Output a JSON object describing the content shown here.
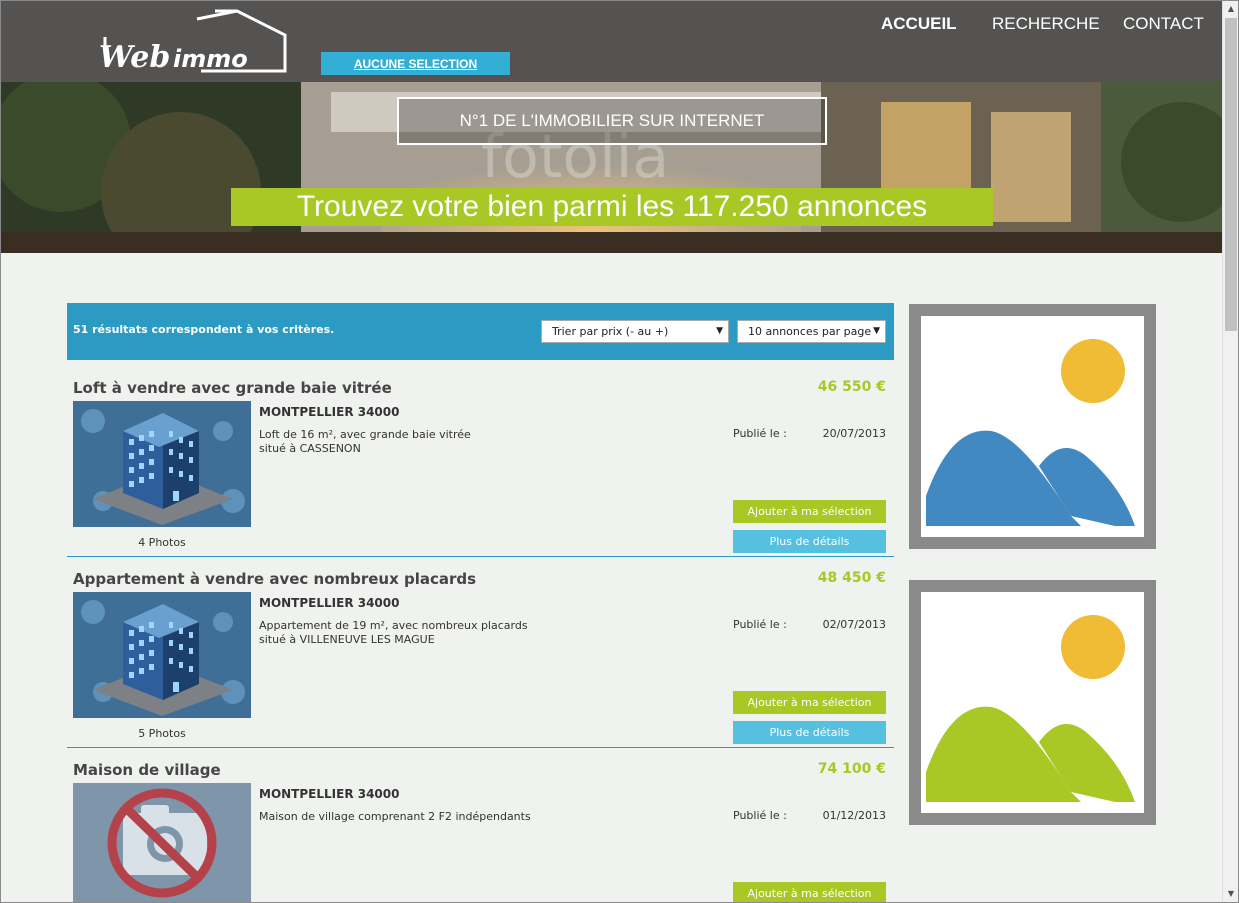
{
  "header": {
    "logo_text": "Webimmo",
    "selection_button": "AUCUNE SELECTION",
    "nav": [
      {
        "label": "ACCUEIL",
        "active": true
      },
      {
        "label": "RECHERCHE",
        "active": false
      },
      {
        "label": "CONTACT",
        "active": false
      }
    ]
  },
  "hero": {
    "watermark": "fotolia",
    "tagline": "N°1 DE L'IMMOBILIER SUR INTERNET",
    "headline": "Trouvez votre bien parmi les 117.250 annonces"
  },
  "results": {
    "count_text": "51 résultats correspondent à vos critères.",
    "sort_select": "Trier par prix (- au +)",
    "per_page_select": "10 annonces par page"
  },
  "listings": [
    {
      "title": "Loft à vendre avec grande baie vitrée",
      "price": "46 550 €",
      "city": "MONTPELLIER 34000",
      "description_lines": [
        "Loft de 16 m², avec grande baie vitrée",
        "situé à CASSENON"
      ],
      "published_label": "Publié le :",
      "published_date": "20/07/2013",
      "photos": "4 Photos",
      "add_button": "Ajouter à ma sélection",
      "details_button": "Plus de détails",
      "thumbnail": "building-icon"
    },
    {
      "title": "Appartement à vendre avec nombreux placards",
      "price": "48 450 €",
      "city": "MONTPELLIER 34000",
      "description_lines": [
        "Appartement de 19 m², avec nombreux placards",
        "situé à VILLENEUVE LES MAGUE"
      ],
      "published_label": "Publié le :",
      "published_date": "02/07/2013",
      "photos": "5 Photos",
      "add_button": "Ajouter à ma sélection",
      "details_button": "Plus de détails",
      "thumbnail": "building-icon"
    },
    {
      "title": "Maison de village",
      "price": "74 100 €",
      "city": "MONTPELLIER 34000",
      "description_lines": [
        "Maison de village comprenant 2 F2 indépendants",
        ""
      ],
      "published_label": "Publié le :",
      "published_date": "01/12/2013",
      "add_button": "Ajouter à ma sélection",
      "thumbnail": "no-photo-icon"
    }
  ],
  "colors": {
    "header_bg": "#545352",
    "accent_blue": "#2b9bc4",
    "accent_green": "#a9c826",
    "light_blue": "#55c0e0"
  }
}
